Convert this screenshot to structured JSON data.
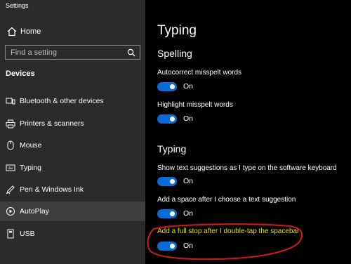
{
  "app": {
    "title": "Settings"
  },
  "sidebar": {
    "home_label": "Home",
    "search_placeholder": "Find a setting",
    "section_title": "Devices",
    "items": [
      {
        "label": "Bluetooth & other devices",
        "icon": "bluetooth-icon",
        "active": false
      },
      {
        "label": "Printers & scanners",
        "icon": "printer-icon",
        "active": false
      },
      {
        "label": "Mouse",
        "icon": "mouse-icon",
        "active": false
      },
      {
        "label": "Typing",
        "icon": "keyboard-icon",
        "active": false
      },
      {
        "label": "Pen & Windows Ink",
        "icon": "pen-icon",
        "active": false
      },
      {
        "label": "AutoPlay",
        "icon": "autoplay-icon",
        "active": true
      },
      {
        "label": "USB",
        "icon": "usb-icon",
        "active": false
      }
    ]
  },
  "main": {
    "title": "Typing",
    "sections": [
      {
        "heading": "Spelling",
        "options": [
          {
            "label": "Autocorrect misspelt words",
            "state": "On"
          },
          {
            "label": "Highlight misspelt words",
            "state": "On"
          }
        ]
      },
      {
        "heading": "Typing",
        "options": [
          {
            "label": "Show text suggestions as I type on the software keyboard",
            "state": "On"
          },
          {
            "label": "Add a space after I choose a text suggestion",
            "state": "On"
          },
          {
            "label": "Add a full stop after I double-tap the spacebar",
            "state": "On"
          }
        ]
      }
    ]
  },
  "colors": {
    "accent": "#0a6cd8",
    "highlight_text": "#e8e000",
    "annotation": "#d81818"
  }
}
